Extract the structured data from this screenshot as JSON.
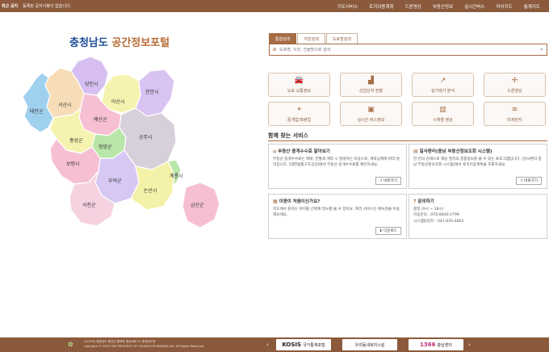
{
  "topbar": {
    "notice_label": "최근 공지",
    "notice_text": "등록된 공지사항이 없습니다.",
    "nav": [
      "지도서비스",
      "토지이용계획",
      "드론영상",
      "부동산정보",
      "실시간버스",
      "마이지도",
      "통계지도"
    ]
  },
  "title": {
    "part1": "충청남도",
    "part2": "공간정보포털"
  },
  "map": {
    "regions": {
      "taean": "태안군",
      "seosan": "서산시",
      "dangjin": "당진시",
      "asan": "아산시",
      "cheonan": "천안시",
      "yesan": "예산군",
      "hongseong": "홍성군",
      "cheongyang": "청양군",
      "gongju": "공주시",
      "boryeong": "보령시",
      "buyeo": "부여군",
      "seocheon": "서천군",
      "nonsan": "논산시",
      "gyeryong": "계룡시",
      "geumsan": "금산군"
    },
    "colors": {
      "taean": "#9fd0ee",
      "seosan": "#f7ddb7",
      "dangjin": "#d6bff0",
      "asan": "#f6f3b0",
      "cheonan": "#d9c3f2",
      "yesan": "#f6bfd3",
      "hongseong": "#f6f3b0",
      "cheongyang": "#b8e6a8",
      "gongju": "#d7cfd9",
      "boryeong": "#f6bfd3",
      "buyeo": "#d6c8f2",
      "seocheon": "#f6d2e1",
      "nonsan": "#f4f1a8",
      "gyeryong": "#b8e6a8",
      "geumsan": "#f6bfd3"
    }
  },
  "search": {
    "tabs": [
      "통합검색",
      "지번검색",
      "도로명검색"
    ],
    "placeholder": "도로명, 지번, 건물명으로 검색"
  },
  "tiles": [
    {
      "icon": "car-icon",
      "glyph": "🚗",
      "label": "도로 교통정보"
    },
    {
      "icon": "factory-icon",
      "glyph": "🏭",
      "label": "산업단지 현황"
    },
    {
      "icon": "chart-icon",
      "glyph": "📈",
      "label": "실거래가 분석"
    },
    {
      "icon": "drone-icon",
      "glyph": "✢",
      "label": "드론영상"
    },
    {
      "icon": "pin-icon",
      "glyph": "📍",
      "label": "중개업/측량업"
    },
    {
      "icon": "bus-icon",
      "glyph": "🚌",
      "label": "실시간 버스정보"
    },
    {
      "icon": "map-icon",
      "glyph": "🗺",
      "label": "시계열 영상"
    },
    {
      "icon": "dust-icon",
      "glyph": "☁",
      "label": "미세먼지"
    }
  ],
  "together": {
    "title": "함께 찾는 서비스",
    "cards": [
      {
        "title": "부동산 중개수수료 알아보기",
        "body": "부동산 중개수수료는 매매, 전월세 계약 시 발생하는 비용으로, 계약금액에 따라 달라집니다. [대한법률구조공단]에서 부동산 중개수수료를 확인하세요.",
        "button": "바로가기"
      },
      {
        "title": "일사편리(충남 부동산정보조회 시스템)",
        "body": "한 번의 검색으로 해당 필지의 종합정보를 볼 수 있는 프로그램입니다. [일사편리 충남 부동산정보조회 시스템]에서 토지이용계획을 조회하세요.",
        "button": "바로가기"
      },
      {
        "title": "이용이 처음이신가요?",
        "body": "지도에서 원하는 위치를 선택해 정보를 볼 수 있어요. 여러 서비스는 메뉴얼을 이용해보세요.",
        "button": "다운로드"
      },
      {
        "title": "문의하기",
        "lines": [
          "평일 (9시 ~ 18시)",
          "이용문의 : 070-8840-2799",
          "시스템담당자 : 041-635-4802"
        ]
      }
    ]
  },
  "footer": {
    "address": "(32256) 충청남도 홍성군 홍북읍 충남대로 21 충청남도청",
    "copyright": "copyright © 2020 THE PROVINCE OF CHUNGCHEONGNAM-DO. All Rights Reserved.",
    "links": [
      {
        "strong": "KOSIS",
        "label": "국가통계포털"
      },
      {
        "strong": "",
        "label": "우리동네복지시설"
      },
      {
        "strong": "1366",
        "label": "충남센터"
      }
    ]
  }
}
